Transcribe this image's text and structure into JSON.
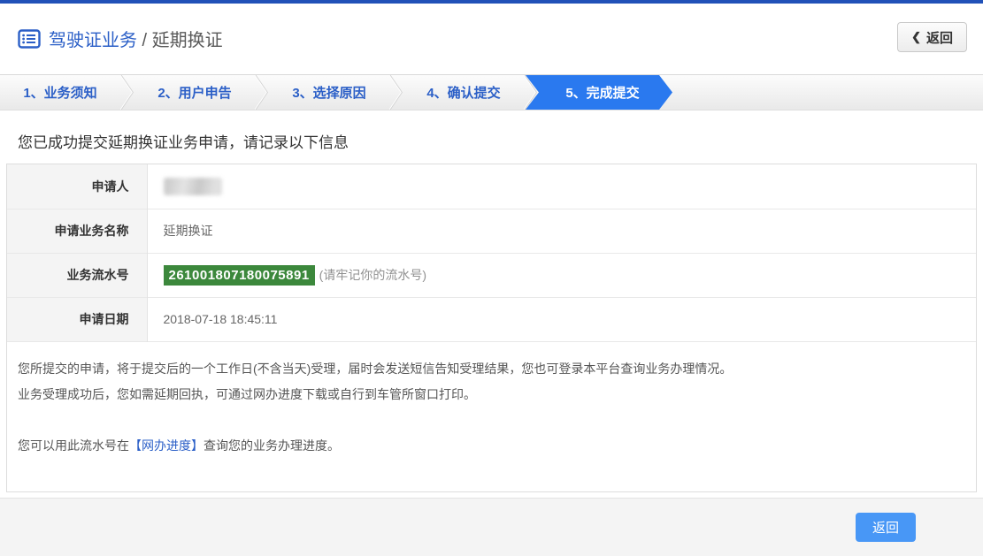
{
  "header": {
    "breadcrumb": {
      "section": "驾驶证业务",
      "separator": " / ",
      "current": "延期换证"
    },
    "back_button": {
      "chevron": "❮",
      "label": "返回"
    }
  },
  "steps": [
    {
      "label": "1、业务须知",
      "active": false
    },
    {
      "label": "2、用户申告",
      "active": false
    },
    {
      "label": "3、选择原因",
      "active": false
    },
    {
      "label": "4、确认提交",
      "active": false
    },
    {
      "label": "5、完成提交",
      "active": true
    }
  ],
  "main": {
    "success_message": "您已成功提交延期换证业务申请，请记录以下信息",
    "table": {
      "rows": [
        {
          "label": "申请人",
          "value": "",
          "masked": true
        },
        {
          "label": "申请业务名称",
          "value": "延期换证"
        },
        {
          "label": "业务流水号",
          "serial": "261001807180075891",
          "note": "(请牢记你的流水号)"
        },
        {
          "label": "申请日期",
          "value": "2018-07-18 18:45:11"
        }
      ]
    },
    "notes": [
      "您所提交的申请，将于提交后的一个工作日(不含当天)受理，届时会发送短信告知受理结果，您也可登录本平台查询业务办理情况。",
      "业务受理成功后，您如需延期回执，可通过网办进度下载或自行到车管所窗口打印。"
    ],
    "progress_note": {
      "prefix": "您可以用此流水号在",
      "link": "【网办进度】",
      "suffix": "查询您的业务办理进度。"
    }
  },
  "footer": {
    "back_button_label": "返回"
  },
  "colors": {
    "top_strip_blue": "#2151b8",
    "accent_blue": "#2b5fc7",
    "active_tab_blue": "#2a79ef",
    "serial_green": "#3c883c",
    "footer_button_blue": "#4897f6"
  }
}
